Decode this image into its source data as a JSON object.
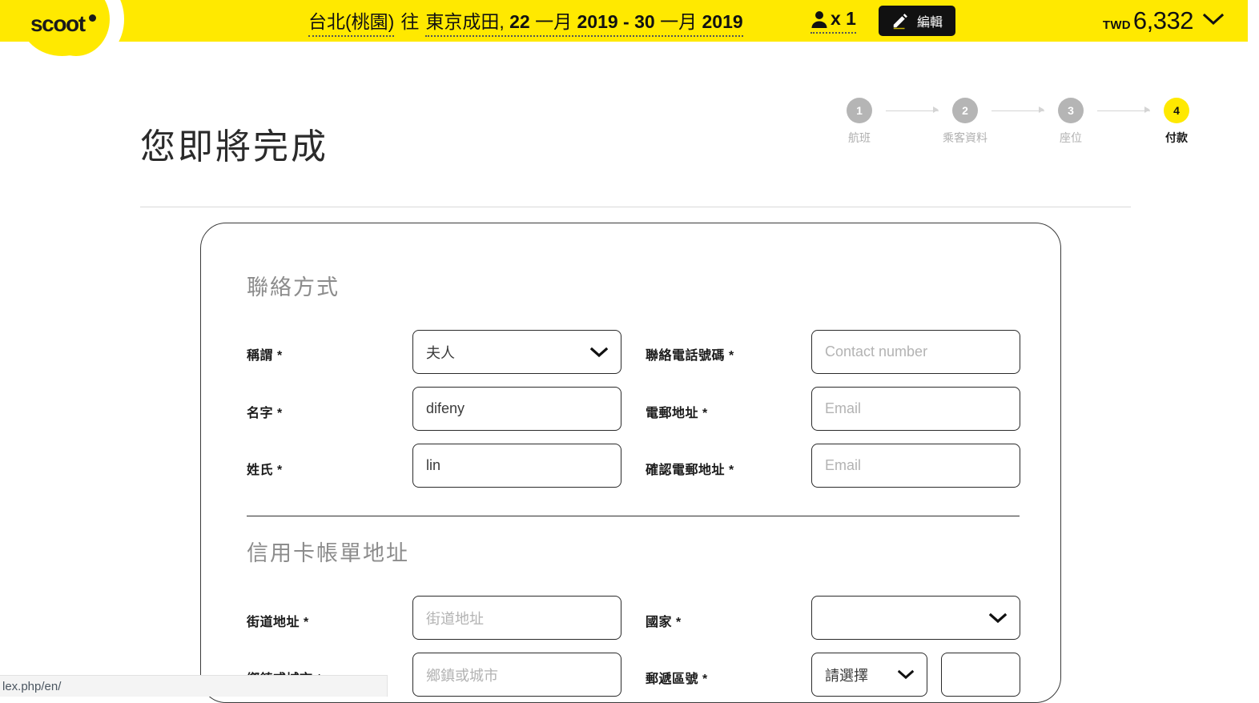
{
  "header": {
    "logo_text": "scoot",
    "route": {
      "origin": "台北(桃園)",
      "connector": "往",
      "destination": "東京成田",
      "comma": ",",
      "depart_day": "22",
      "depart_month": "一月",
      "depart_year": "2019",
      "range_dash": "-",
      "return_day": "30",
      "return_month": "一月",
      "return_year": "2019"
    },
    "pax_count": "x 1",
    "pax_icon": "person-icon",
    "edit_label": "編輯",
    "edit_icon": "pencil-icon",
    "currency": "TWD",
    "amount": "6,332",
    "price_chevron_icon": "chevron-down-icon",
    "bg_color": "#ffe900"
  },
  "main": {
    "page_title": "您即將完成",
    "stepper": [
      {
        "num": "1",
        "label": "航班",
        "active": false
      },
      {
        "num": "2",
        "label": "乘客資料",
        "active": false
      },
      {
        "num": "3",
        "label": "座位",
        "active": false
      },
      {
        "num": "4",
        "label": "付款",
        "active": true
      }
    ],
    "accent_color": "#ffe900",
    "inactive_color": "#b5b5b5"
  },
  "form": {
    "contact_section_title": "聯絡方式",
    "billing_section_title": "信用卡帳單地址",
    "fields": {
      "title": {
        "label": "稱謂 *",
        "value": "夫人",
        "type": "select"
      },
      "first_name": {
        "label": "名字 *",
        "value": "difeny",
        "placeholder": "",
        "type": "text"
      },
      "last_name": {
        "label": "姓氏 *",
        "value": "lin",
        "placeholder": "",
        "type": "text"
      },
      "phone": {
        "label": "聯絡電話號碼 *",
        "value": "",
        "placeholder": "Contact number",
        "type": "text"
      },
      "email": {
        "label": "電郵地址 *",
        "value": "",
        "placeholder": "Email",
        "type": "text"
      },
      "email_confirm": {
        "label": "確認電郵地址 *",
        "value": "",
        "placeholder": "Email",
        "type": "text"
      },
      "street": {
        "label": "街道地址 *",
        "value": "",
        "placeholder": "街道地址",
        "type": "text"
      },
      "country": {
        "label": "國家 *",
        "value": "",
        "type": "select"
      },
      "city": {
        "label": "鄉鎮或城市 *",
        "value": "",
        "placeholder": "鄉鎮或城市",
        "type": "text"
      },
      "postcode": {
        "label": "郵遞區號 *",
        "value": "請選擇",
        "type": "select"
      },
      "postcode_extra": {
        "label": "",
        "value": "",
        "placeholder": "",
        "type": "text"
      }
    }
  },
  "browser": {
    "status_url": "lex.php/en/"
  }
}
